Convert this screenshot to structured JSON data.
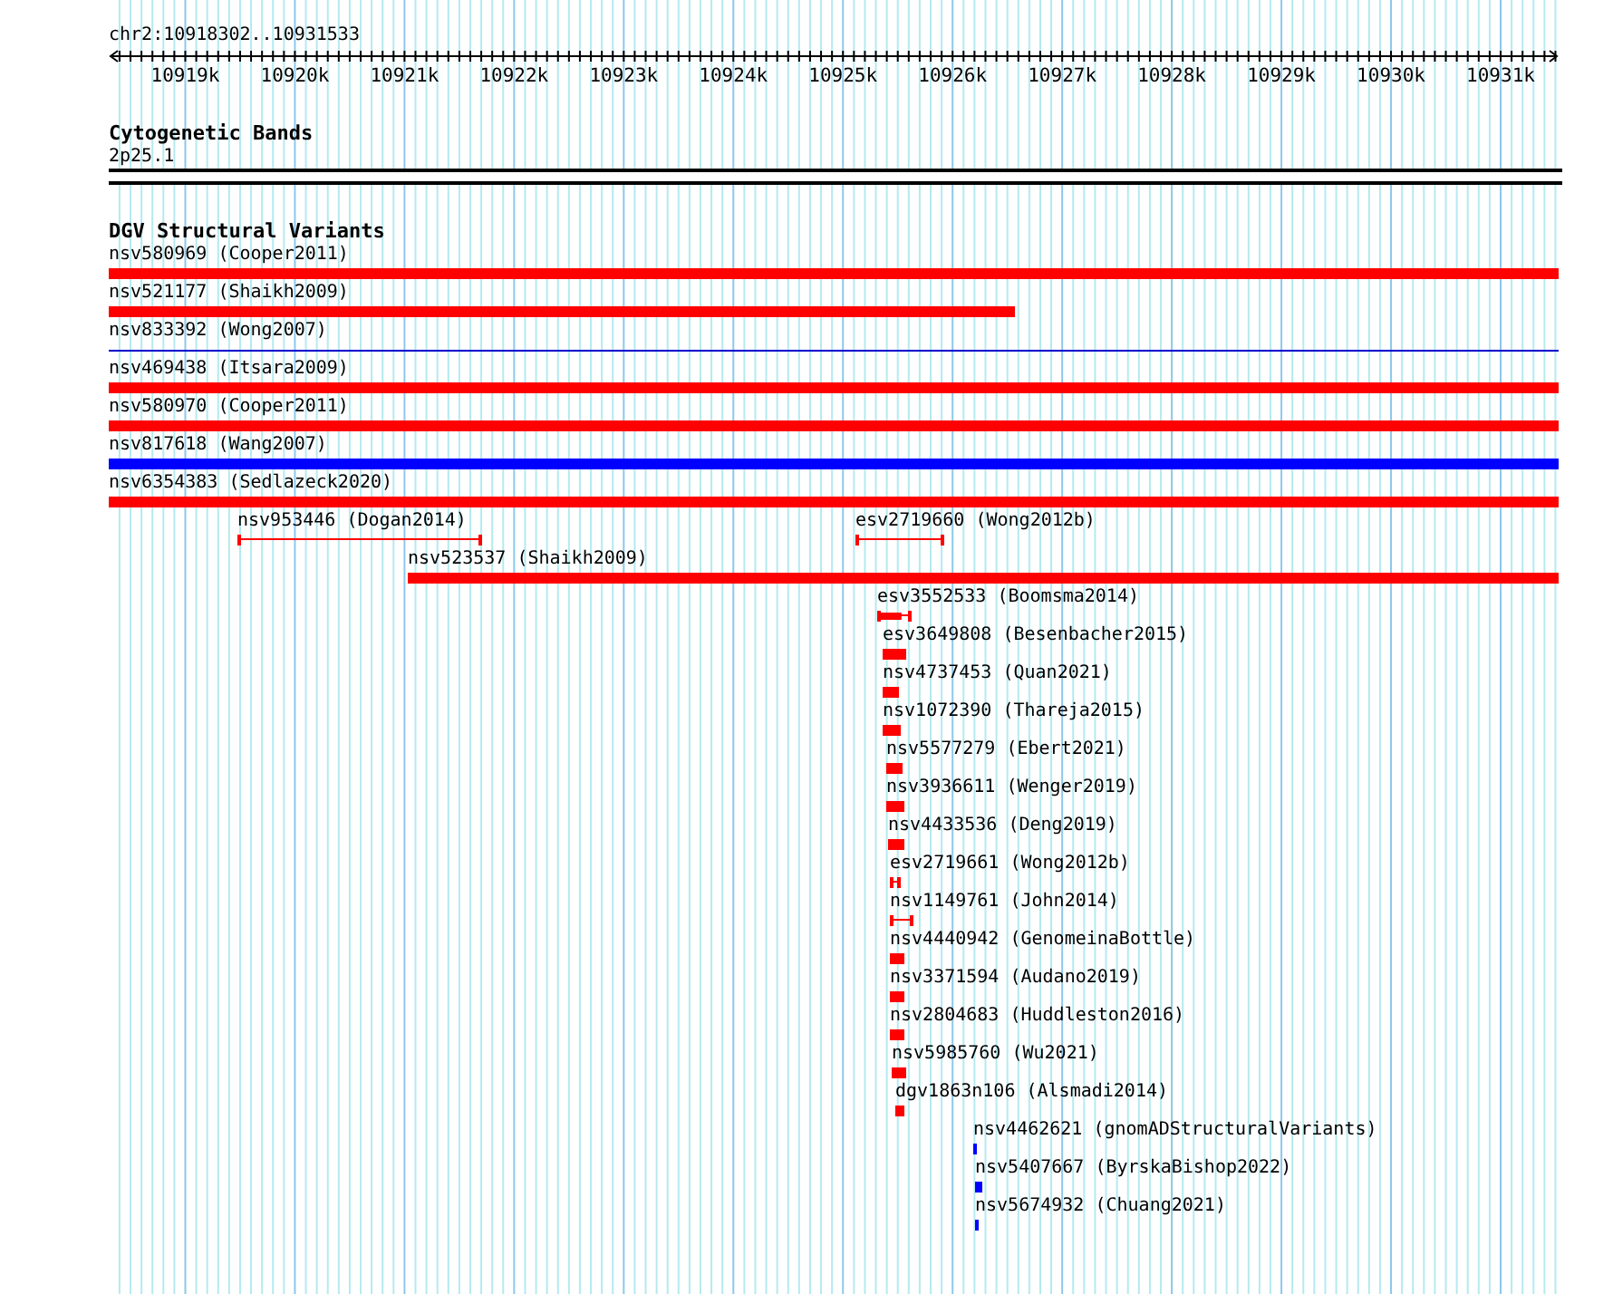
{
  "view": {
    "location": "chr2:10918302..10931533"
  },
  "ruler": {
    "labels": [
      "10919k",
      "10920k",
      "10921k",
      "10922k",
      "10923k",
      "10924k",
      "10925k",
      "10926k",
      "10927k",
      "10928k",
      "10929k",
      "10930k",
      "10931k"
    ]
  },
  "cytogenetic_bands": {
    "title": "Cytogenetic Bands",
    "band": "2p25.1"
  },
  "dgv_track": {
    "title": "DGV Structural Variants",
    "rows": [
      {
        "features": [
          {
            "label": "nsv580969 (Cooper2011)",
            "kind": "bar",
            "color": "#ff0000"
          }
        ]
      },
      {
        "features": [
          {
            "label": "nsv521177 (Shaikh2009)",
            "kind": "bar",
            "color": "#ff0000"
          }
        ]
      },
      {
        "features": [
          {
            "label": "nsv833392 (Wong2007)",
            "kind": "line",
            "color": "#0000cc"
          }
        ]
      },
      {
        "features": [
          {
            "label": "nsv469438 (Itsara2009)",
            "kind": "bar",
            "color": "#ff0000"
          }
        ]
      },
      {
        "features": [
          {
            "label": "nsv580970 (Cooper2011)",
            "kind": "bar",
            "color": "#ff0000"
          }
        ]
      },
      {
        "features": [
          {
            "label": "nsv817618 (Wang2007)",
            "kind": "bar",
            "color": "#0000ff"
          }
        ]
      },
      {
        "features": [
          {
            "label": "nsv6354383 (Sedlazeck2020)",
            "kind": "bar",
            "color": "#ff0000"
          }
        ]
      },
      {
        "features": [
          {
            "label": "nsv953446 (Dogan2014)",
            "kind": "span",
            "color": "#ff0000"
          },
          {
            "label": "esv2719660 (Wong2012b)",
            "kind": "span",
            "color": "#ff0000"
          }
        ]
      },
      {
        "features": [
          {
            "label": "nsv523537 (Shaikh2009)",
            "kind": "bar",
            "color": "#ff0000"
          }
        ]
      },
      {
        "features": [
          {
            "label": "esv3552533 (Boomsma2014)",
            "kind": "capped",
            "color": "#ff0000"
          }
        ]
      },
      {
        "features": [
          {
            "label": "esv3649808 (Besenbacher2015)",
            "kind": "bar",
            "color": "#ff0000"
          }
        ]
      },
      {
        "features": [
          {
            "label": "nsv4737453 (Quan2021)",
            "kind": "bar",
            "color": "#ff0000"
          }
        ]
      },
      {
        "features": [
          {
            "label": "nsv1072390 (Thareja2015)",
            "kind": "bar",
            "color": "#ff0000"
          }
        ]
      },
      {
        "features": [
          {
            "label": "nsv5577279 (Ebert2021)",
            "kind": "bar",
            "color": "#ff0000"
          }
        ]
      },
      {
        "features": [
          {
            "label": "nsv3936611 (Wenger2019)",
            "kind": "bar",
            "color": "#ff0000"
          }
        ]
      },
      {
        "features": [
          {
            "label": "nsv4433536 (Deng2019)",
            "kind": "bar",
            "color": "#ff0000"
          }
        ]
      },
      {
        "features": [
          {
            "label": "esv2719661 (Wong2012b)",
            "kind": "span",
            "color": "#ff0000"
          }
        ]
      },
      {
        "features": [
          {
            "label": "nsv1149761 (John2014)",
            "kind": "span",
            "color": "#ff0000"
          }
        ]
      },
      {
        "features": [
          {
            "label": "nsv4440942 (GenomeinaBottle)",
            "kind": "bar",
            "color": "#ff0000"
          }
        ]
      },
      {
        "features": [
          {
            "label": "nsv3371594 (Audano2019)",
            "kind": "bar",
            "color": "#ff0000"
          }
        ]
      },
      {
        "features": [
          {
            "label": "nsv2804683 (Huddleston2016)",
            "kind": "bar",
            "color": "#ff0000"
          }
        ]
      },
      {
        "features": [
          {
            "label": "nsv5985760 (Wu2021)",
            "kind": "bar",
            "color": "#ff0000"
          }
        ]
      },
      {
        "features": [
          {
            "label": "dgv1863n106 (Alsmadi2014)",
            "kind": "bar",
            "color": "#ff0000"
          }
        ]
      },
      {
        "features": [
          {
            "label": "nsv4462621 (gnomADStructuralVariants)",
            "kind": "bar",
            "color": "#0000ff"
          }
        ]
      },
      {
        "features": [
          {
            "label": "nsv5407667 (ByrskaBishop2022)",
            "kind": "bar",
            "color": "#0000ff"
          }
        ]
      },
      {
        "features": [
          {
            "label": "nsv5674932 (Chuang2021)",
            "kind": "bar",
            "color": "#0000ff"
          }
        ]
      }
    ]
  }
}
